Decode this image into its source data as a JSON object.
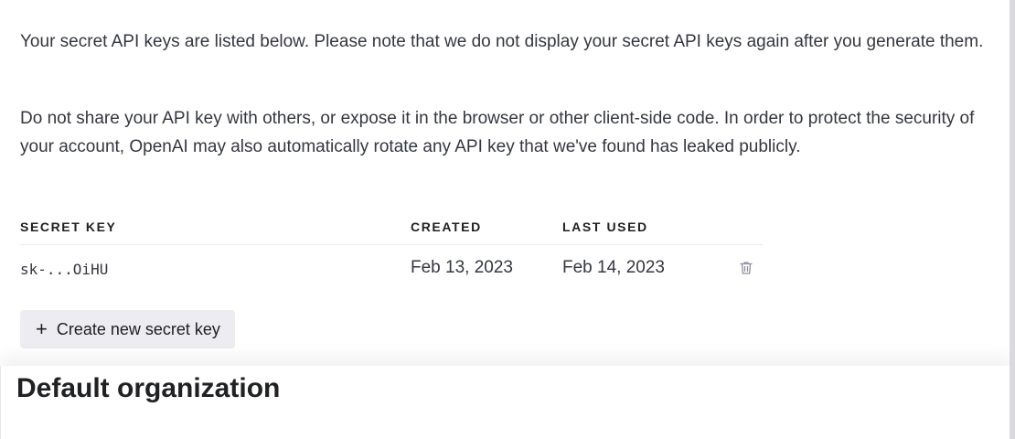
{
  "intro": {
    "paragraph_1": "Your secret API keys are listed below. Please note that we do not display your secret API keys again after you generate them.",
    "paragraph_2": "Do not share your API key with others, or expose it in the browser or other client-side code. In order to protect the security of your account, OpenAI may also automatically rotate any API key that we've found has leaked publicly."
  },
  "table": {
    "headers": {
      "secret_key": "SECRET KEY",
      "created": "CREATED",
      "last_used": "LAST USED"
    },
    "rows": [
      {
        "secret_key": "sk-...OiHU",
        "created": "Feb 13, 2023",
        "last_used": "Feb 14, 2023",
        "action_icon": "trash-icon"
      }
    ]
  },
  "create_button": {
    "icon": "plus-icon",
    "label": "Create new secret key"
  },
  "next_section": {
    "title": "Default organization"
  },
  "colors": {
    "text": "#353740",
    "heading": "#202123",
    "button_bg": "#ececf1",
    "divider": "#ececf1"
  }
}
